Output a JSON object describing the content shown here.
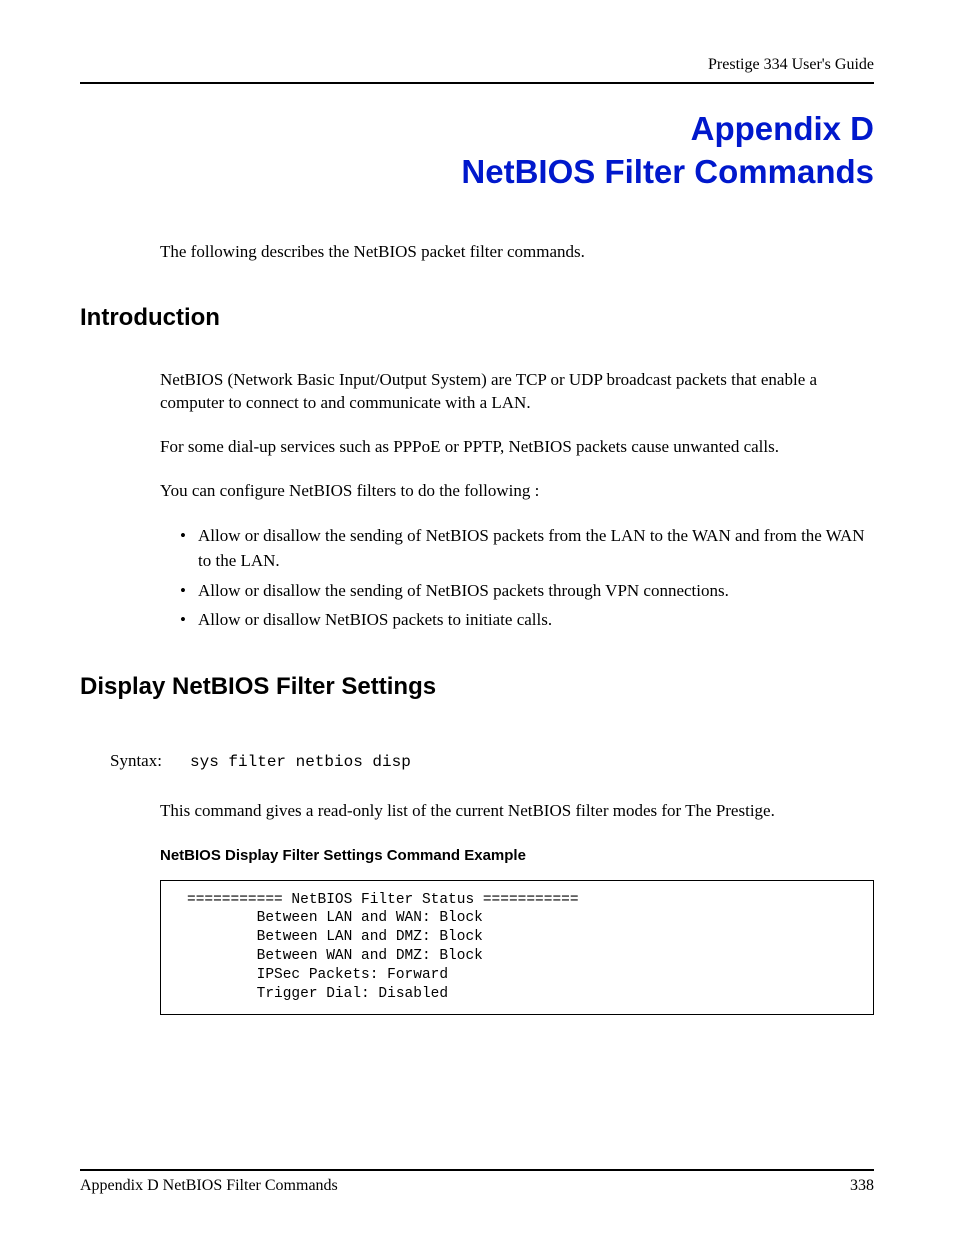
{
  "header": {
    "guide": "Prestige 334 User's Guide"
  },
  "title": {
    "line1": "Appendix D",
    "line2": "NetBIOS Filter Commands"
  },
  "intro": "The following describes the NetBIOS packet filter commands.",
  "section1": {
    "heading": "Introduction",
    "para1": "NetBIOS (Network Basic Input/Output System) are TCP or UDP broadcast packets that enable a computer to connect to and communicate with a LAN.",
    "para2": "For some dial-up services such as PPPoE or PPTP, NetBIOS packets cause unwanted calls.",
    "para3": "You can configure NetBIOS filters to do the following :",
    "bullets": [
      "Allow or disallow the sending of NetBIOS packets from the LAN to the WAN and from the WAN to the LAN.",
      "Allow or disallow the sending of NetBIOS packets through VPN connections.",
      "Allow or disallow NetBIOS packets to initiate calls."
    ]
  },
  "section2": {
    "heading": "Display NetBIOS Filter Settings",
    "syntax_label": "Syntax:",
    "syntax_cmd": "sys filter netbios disp",
    "para1": "This command gives a read-only list of the current NetBIOS filter modes for The Prestige.",
    "example_heading": "NetBIOS Display Filter Settings Command Example",
    "code": "=========== NetBIOS Filter Status ===========\n        Between LAN and WAN: Block\n        Between LAN and DMZ: Block\n        Between WAN and DMZ: Block\n        IPSec Packets: Forward\n        Trigger Dial: Disabled"
  },
  "footer": {
    "left": "Appendix D NetBIOS Filter Commands",
    "right": "338"
  }
}
